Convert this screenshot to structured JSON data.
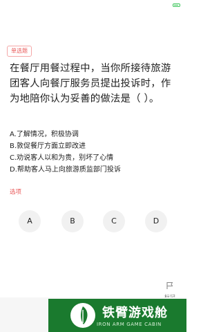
{
  "status_bar": {
    "battery_level": 0.7,
    "accent_color": "#3cc65a"
  },
  "question": {
    "type_tag": "单选题",
    "text": "在餐厅用餐过程中，当你所接待旅游团客人向餐厅服务员提出投诉时，作为地陪你认为妥善的做法是（ ）。",
    "options": [
      "A.了解情况，积极协调",
      "B.敦促餐厅方面立即改进",
      "C.劝说客人以和为贵，别坏了心情",
      "D.帮助客人马上向旅游质监部门投诉"
    ],
    "section_label": "选项",
    "answers": [
      "A",
      "B",
      "C",
      "D"
    ]
  },
  "footer": {
    "mark_label": "标记",
    "mark_icon": "flag-icon"
  },
  "watermark": {
    "title": "铁臂游戏舱",
    "subtitle": "IRON ARM GAME CABIN",
    "brand_color": "#1a7a2e"
  },
  "colors": {
    "accent": "#e85a5a",
    "button_bg": "#f1f1f1"
  }
}
